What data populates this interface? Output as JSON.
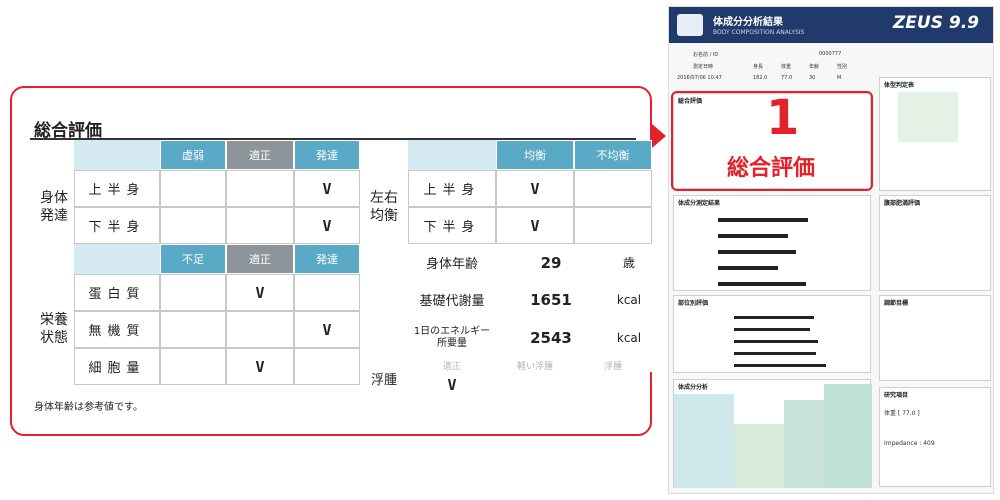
{
  "section_title": "総合評価",
  "development": {
    "label": "身体\n発達",
    "headers": [
      "虚弱",
      "適正",
      "発達"
    ],
    "rows": [
      {
        "label": "上半身",
        "marks": [
          "",
          "",
          "V"
        ]
      },
      {
        "label": "下半身",
        "marks": [
          "",
          "",
          "V"
        ]
      }
    ]
  },
  "balance": {
    "label": "左右\n均衡",
    "headers": [
      "均衡",
      "不均衡"
    ],
    "rows": [
      {
        "label": "上半身",
        "marks": [
          "V",
          ""
        ]
      },
      {
        "label": "下半身",
        "marks": [
          "V",
          ""
        ]
      }
    ]
  },
  "nutrition": {
    "label": "栄養\n状態",
    "headers": [
      "不足",
      "適正",
      "発達"
    ],
    "rows": [
      {
        "label": "蛋白質",
        "marks": [
          "",
          "V",
          ""
        ]
      },
      {
        "label": "無機質",
        "marks": [
          "",
          "",
          "V"
        ]
      },
      {
        "label": "細胞量",
        "marks": [
          "",
          "V",
          ""
        ]
      }
    ]
  },
  "metrics": [
    {
      "label": "身体年齢",
      "value": "29",
      "unit": "歳"
    },
    {
      "label": "基礎代謝量",
      "value": "1651",
      "unit": "kcal"
    },
    {
      "label": "1日のエネルギー\n所要量",
      "value": "2543",
      "unit": "kcal"
    }
  ],
  "edema": {
    "label": "浮腫",
    "headers": [
      "適正",
      "軽い浮腫",
      "浮腫"
    ],
    "mark": "V"
  },
  "footnote": "身体年齢は参考値です。",
  "callout_number": "1",
  "callout_label": "総合評価",
  "report": {
    "title": "体成分分析結果",
    "subtitle": "BODY COMPOSITION ANALYSIS",
    "logo": "ZEUS 9.9",
    "name_label": "お名前 / ID",
    "id_value": "0000777",
    "date_label": "測定日時",
    "date": "2016/07/06 10:47",
    "height": "182.0",
    "weight": "77.0",
    "age": "30",
    "sex": "M",
    "sections": [
      "総合評価",
      "体型判定表",
      "体成分測定結果",
      "腹部肥満評価",
      "部位別評価",
      "調節目標",
      "体成分分析",
      "研究項目"
    ],
    "col_headers": [
      "身長",
      "体重",
      "年齢",
      "性別"
    ],
    "weight_box": "体重 [ 77.0 ]",
    "impedance": "Impedance : 409"
  }
}
